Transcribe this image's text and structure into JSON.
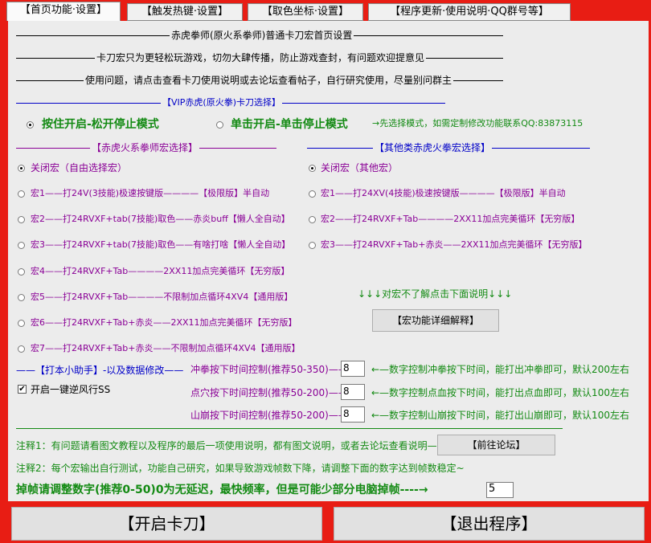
{
  "tabs": [
    "【首页功能·设置】",
    "【触发热键·设置】",
    "【取色坐标·设置】",
    "【程序更新·使用说明·QQ群号等】"
  ],
  "header": {
    "line1": "赤虎拳师(原火系拳师)普通卡刀宏首页设置",
    "line2": "卡刀宏只为更轻松玩游戏，切勿大肆传播，防止游戏查封，有问题欢迎提意见",
    "line3": "使用问题，请点击查看卡刀使用说明或去论坛查看帖子，自行研究使用，尽量别问群主"
  },
  "vip": {
    "title": "【VIP赤虎(原火拳)卡刀选择】",
    "option_hold": "按住开启-松开停止模式",
    "option_click": "单击开启-单击停止模式",
    "note": "→先选择模式，如需定制修改功能联系QQ:83873115"
  },
  "left_group": {
    "title": "【赤虎火系拳师宏选择】",
    "items": [
      "关闭宏（自由选择宏）",
      "宏1——打24V(3技能)极速按键版————【极限版】半自动",
      "宏2——打24RVXF+tab(7技能)取色——赤炎buff【懒人全自动】",
      "宏3——打24RVXF+tab(7技能)取色——有啥打啥【懒人全自动】",
      "宏4——打24RVXF+Tab————2XX11加点完美循环【无穷版】",
      "宏5——打24RVXF+Tab————不限制加点循环4XV4【通用版】",
      "宏6——打24RVXF+Tab+赤炎——2XX11加点完美循环【无穷版】",
      "宏7——打24RVXF+Tab+赤炎——不限制加点循环4XV4【通用版】"
    ]
  },
  "right_group": {
    "title": "【其他类赤虎火拳宏选择】",
    "items": [
      "关闭宏（其他宏）",
      "宏1——打24XV(4技能)极速按键版————【极限版】半自动",
      "宏2——打24RVXF+Tab————2XX11加点完美循环【无穷版】",
      "宏3——打24RVXF+Tab+赤炎——2XX11加点完美循环【无穷版】"
    ],
    "tip": "↓↓↓对宏不了解点击下面说明↓↓↓",
    "detail_button": "【宏功能详细解释】"
  },
  "helper": {
    "title": "——【打本小助手】-以及数据修改——",
    "checkbox_label": "开启一键逆风行SS",
    "checkbox_checked": true
  },
  "timing": [
    {
      "label": "冲拳按下时间控制(推荐50-350)——",
      "value": "8",
      "note": "←—数字控制冲拳按下时间，能打出冲拳即可，默认200左右"
    },
    {
      "label": "点穴按下时间控制(推荐50-200)——",
      "value": "8",
      "note": "←—数字控制点血按下时间，能打出点血即可，默认100左右"
    },
    {
      "label": "山崩按下时间控制(推荐50-200)——",
      "value": "8",
      "note": "←—数字控制山崩按下时间，能打出山崩即可，默认100左右"
    }
  ],
  "notes": {
    "note1": "注释1：有问题请看图文教程以及程序的最后一项使用说明，都有图文说明，或者去论坛查看说明————",
    "forum_button": "【前往论坛】",
    "note2": "注释2：每个宏输出自行测试，功能自己研究，如果导致游戏帧数下降，请调整下面的数字达到帧数稳定~",
    "frame_label": "掉帧请调整数字(推荐0-50)0为无延迟，最快频率，但是可能少部分电脑掉帧----→",
    "frame_value": "5"
  },
  "buttons": {
    "start": "【开启卡刀】",
    "exit": "【退出程序】"
  }
}
